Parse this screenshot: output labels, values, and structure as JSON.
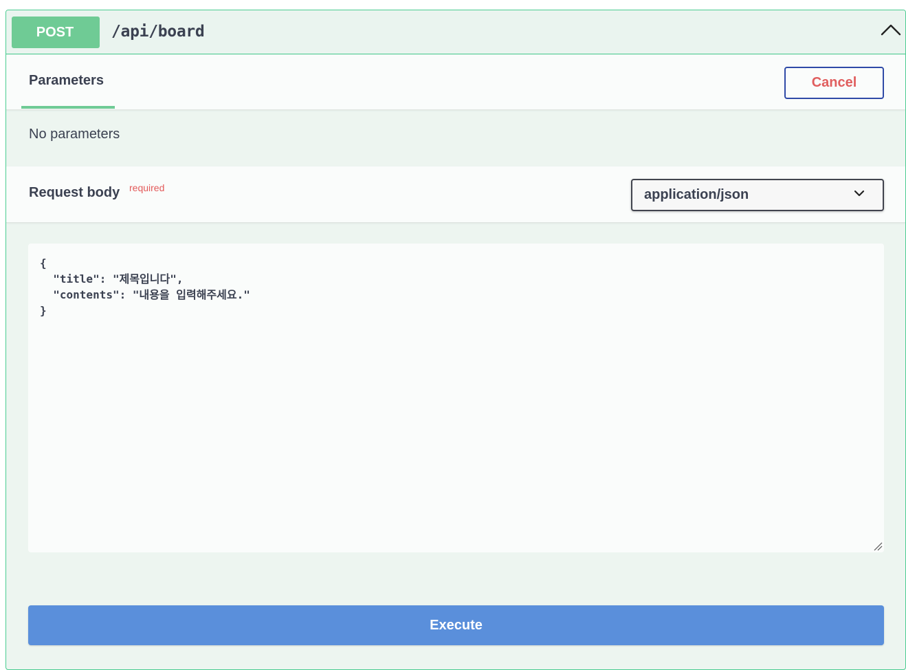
{
  "summary": {
    "method": "POST",
    "path": "/api/board",
    "collapse_icon": "chevron-up-icon"
  },
  "parameters": {
    "tab_label": "Parameters",
    "cancel_label": "Cancel",
    "empty_text": "No parameters"
  },
  "request_body": {
    "title": "Request body",
    "required_label": "required",
    "content_type": "application/json",
    "content_type_icon": "chevron-down-icon",
    "editor_value": "{\n  \"title\": \"제목입니다\",\n  \"contents\": \"내용을 입력해주세요.\"\n}"
  },
  "execute_label": "Execute",
  "colors": {
    "method_post": "#6fcb95",
    "border_accent": "#49cc90",
    "cancel_border": "#2f4aa7",
    "cancel_text": "#e05e5e",
    "required_text": "#e35a5a",
    "execute_bg": "#5a8fdb",
    "panel_bg": "#edf5f0"
  }
}
